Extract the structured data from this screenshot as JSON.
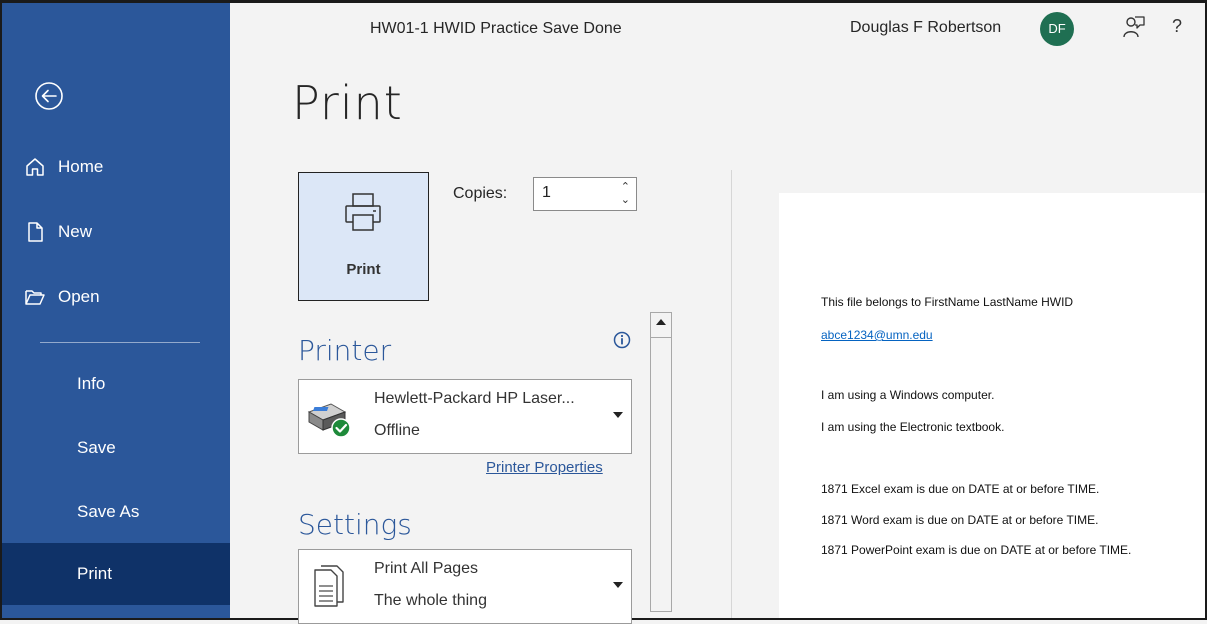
{
  "titlebar": {
    "document_title": "HW01-1 HWID Practice Save Done",
    "user_name": "Douglas F Robertson",
    "user_initials": "DF",
    "help_label": "?"
  },
  "sidebar": {
    "back_icon": "back-arrow-circle-icon",
    "items": [
      {
        "label": "Home",
        "icon": "home-icon"
      },
      {
        "label": "New",
        "icon": "new-document-icon"
      },
      {
        "label": "Open",
        "icon": "open-folder-icon"
      },
      {
        "label": "Info"
      },
      {
        "label": "Save"
      },
      {
        "label": "Save As"
      },
      {
        "label": "Print",
        "active": true
      }
    ],
    "colors": {
      "background": "#2b579a",
      "active": "#0f3268"
    }
  },
  "page": {
    "title": "Print"
  },
  "print_panel": {
    "print_button_label": "Print",
    "copies_label": "Copies:",
    "copies_value": "1"
  },
  "printer": {
    "heading": "Printer",
    "name": "Hewlett-Packard HP Laser...",
    "status": "Offline",
    "properties_link": "Printer Properties"
  },
  "settings": {
    "heading": "Settings",
    "pages_option": "Print All Pages",
    "pages_option_detail": "The whole thing"
  },
  "preview": {
    "lines": [
      "This file belongs to FirstName LastName HWID",
      "abce1234@umn.edu",
      "I am using a Windows computer.",
      "I am using the Electronic textbook.",
      "1871 Excel exam is due on DATE at or before TIME.",
      "1871 Word exam is due on DATE at or before TIME.",
      "1871 PowerPoint exam is due on DATE at or before TIME."
    ]
  }
}
